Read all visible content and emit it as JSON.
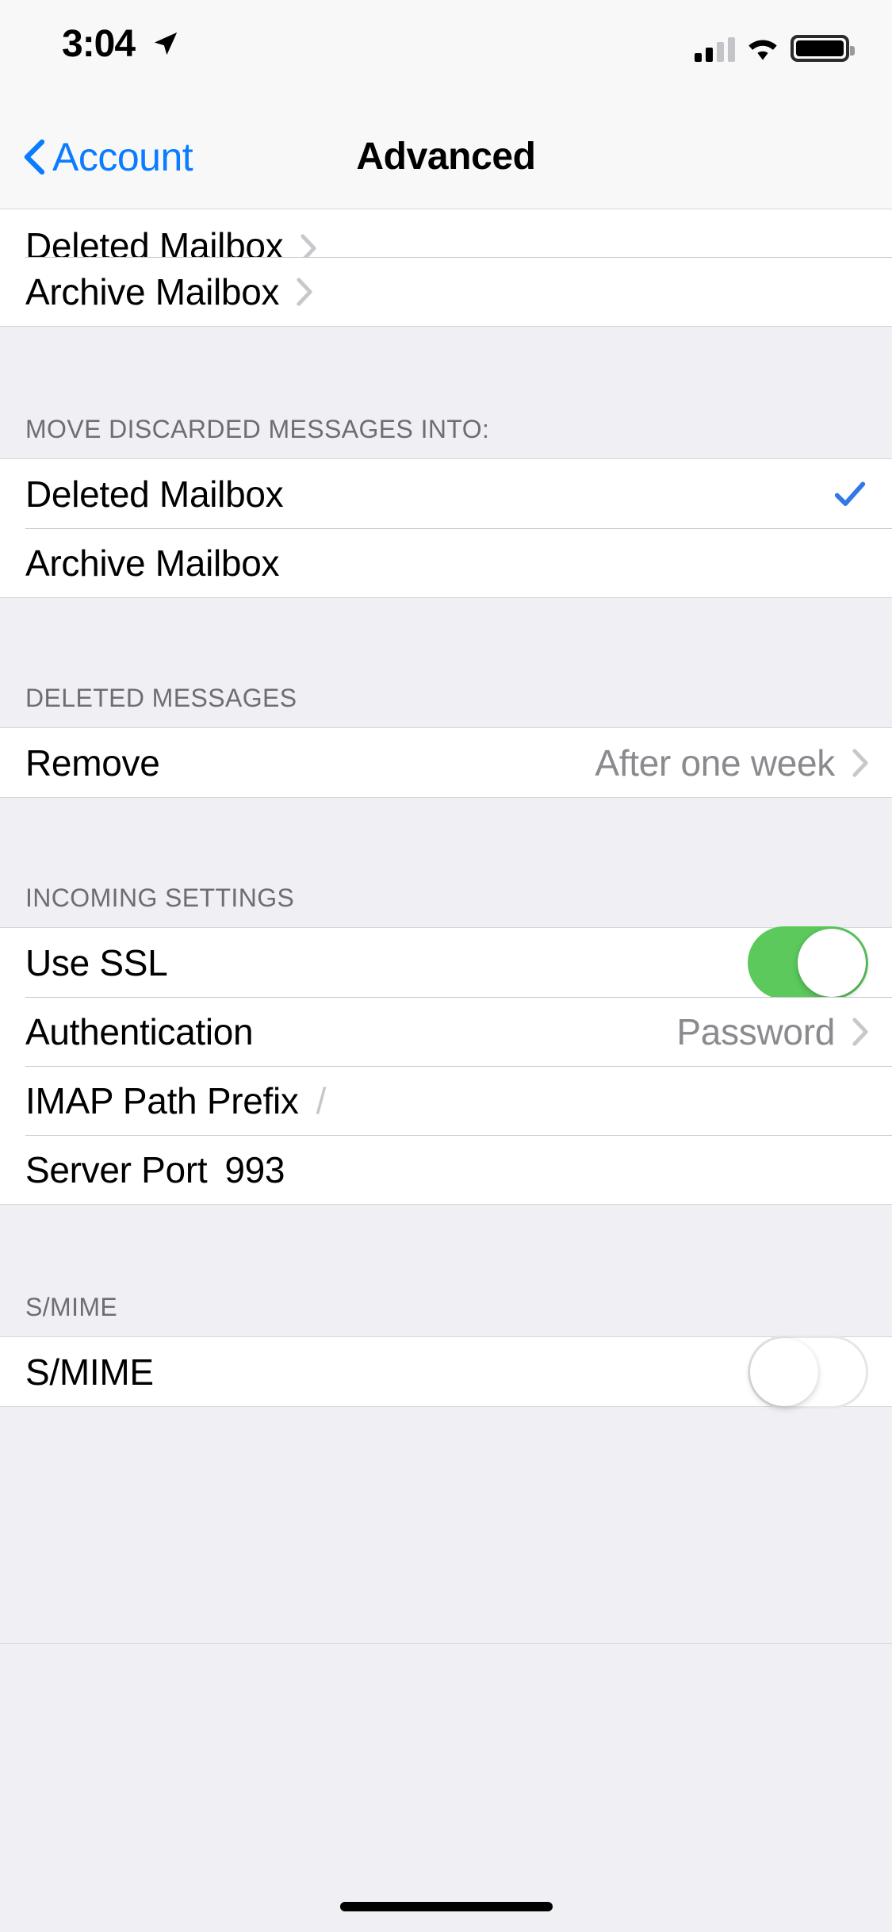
{
  "status_bar": {
    "time": "3:04",
    "location_icon": "location-arrow-icon",
    "cellular_icon": "cellular-bars-icon",
    "wifi_icon": "wifi-icon",
    "battery_icon": "battery-icon"
  },
  "nav": {
    "back_label": "Account",
    "back_icon": "chevron-left-icon",
    "title": "Advanced"
  },
  "sections": [
    {
      "header": "",
      "rows": [
        {
          "label": "Deleted Mailbox",
          "accessory": "chevron",
          "clipped": true
        },
        {
          "label": "Archive Mailbox",
          "accessory": "chevron"
        }
      ]
    },
    {
      "header": "MOVE DISCARDED MESSAGES INTO:",
      "rows": [
        {
          "label": "Deleted Mailbox",
          "accessory": "checkmark"
        },
        {
          "label": "Archive Mailbox",
          "accessory": "none"
        }
      ]
    },
    {
      "header": "DELETED MESSAGES",
      "rows": [
        {
          "label": "Remove",
          "value": "After one week",
          "accessory": "chevron"
        }
      ]
    },
    {
      "header": "INCOMING SETTINGS",
      "rows": [
        {
          "label": "Use SSL",
          "accessory": "switch-on"
        },
        {
          "label": "Authentication",
          "value": "Password",
          "accessory": "chevron"
        },
        {
          "label": "IMAP Path Prefix",
          "value": "/",
          "accessory": "inline-placeholder"
        },
        {
          "label": "Server Port",
          "value": "993",
          "accessory": "inline-value"
        }
      ]
    },
    {
      "header": "S/MIME",
      "rows": [
        {
          "label": "S/MIME",
          "accessory": "switch-off"
        }
      ]
    }
  ],
  "colors": {
    "accent_blue": "#0A7CFF",
    "checkmark_blue": "#3478E8",
    "switch_green": "#5BC95B",
    "group_background": "#EFEFF4",
    "separator": "#C8C7CC",
    "secondary_text": "#8A8A8F",
    "header_text": "#6D6D72"
  },
  "home_indicator": "home-indicator"
}
